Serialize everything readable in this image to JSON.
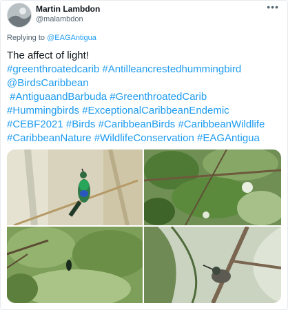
{
  "author": {
    "name": "Martin Lambdon",
    "handle": "@malambdon",
    "avatar_icon": "avatar-photo"
  },
  "more_icon": "more-horizontal-icon",
  "reply": {
    "prefix": "Replying to",
    "target": "@EAGAntigua"
  },
  "tweet": {
    "text": "The affect of light!",
    "hashtag_lines": [
      "#greenthroatedcarib #Antilleancrestedhummingbird",
      "@BirdsCaribbean",
      " #AntiguaandBarbuda #GreenthroatedCarib",
      "#Hummingbirds #ExceptionalCaribbeanEndemic",
      "#CEBF2021 #Birds #CaribbeanBirds #CaribbeanWildlife",
      "#CaribbeanNature #WildlifeConservation #EAGAntigua"
    ]
  },
  "photos": [
    {
      "subject": "green-throated-carib-perched"
    },
    {
      "subject": "leafy-branches"
    },
    {
      "subject": "bird-in-foliage"
    },
    {
      "subject": "antillean-crested-hummingbird-on-branch"
    }
  ],
  "colors": {
    "link": "#1d9bf0",
    "secondary_text": "#536471",
    "border": "#e6ecf0"
  }
}
